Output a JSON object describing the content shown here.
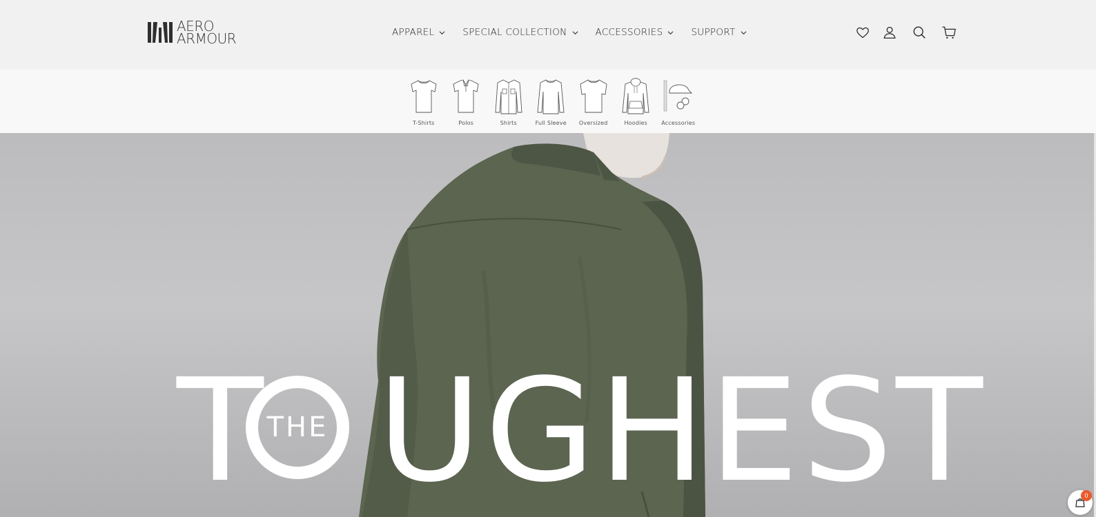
{
  "brand": {
    "line1": "AERO",
    "line2": "ARMOUR"
  },
  "nav": [
    {
      "label": "APPAREL"
    },
    {
      "label": "SPECIAL COLLECTION"
    },
    {
      "label": "ACCESSORIES"
    },
    {
      "label": "SUPPORT"
    }
  ],
  "header_icons": [
    "heart-icon",
    "account-icon",
    "search-icon",
    "cart-icon"
  ],
  "categories": [
    {
      "label": "T-Shirts",
      "icon": "tshirt-icon"
    },
    {
      "label": "Polos",
      "icon": "polo-icon"
    },
    {
      "label": "Shirts",
      "icon": "shirt-icon"
    },
    {
      "label": "Full Sleeve",
      "icon": "full-sleeve-icon"
    },
    {
      "label": "Oversized",
      "icon": "oversized-icon"
    },
    {
      "label": "Hoodies",
      "icon": "hoodie-icon"
    },
    {
      "label": "Accessories",
      "icon": "accessories-icon"
    }
  ],
  "hero": {
    "small_word": "THE",
    "big_word": "TOUGHEST",
    "shirt_color": "#5b6550"
  },
  "cart_widget": {
    "count": "0"
  },
  "colors": {
    "header_bg": "#f1f1f1",
    "strip_bg": "#f8f8f8",
    "badge": "#ec5a2c"
  }
}
